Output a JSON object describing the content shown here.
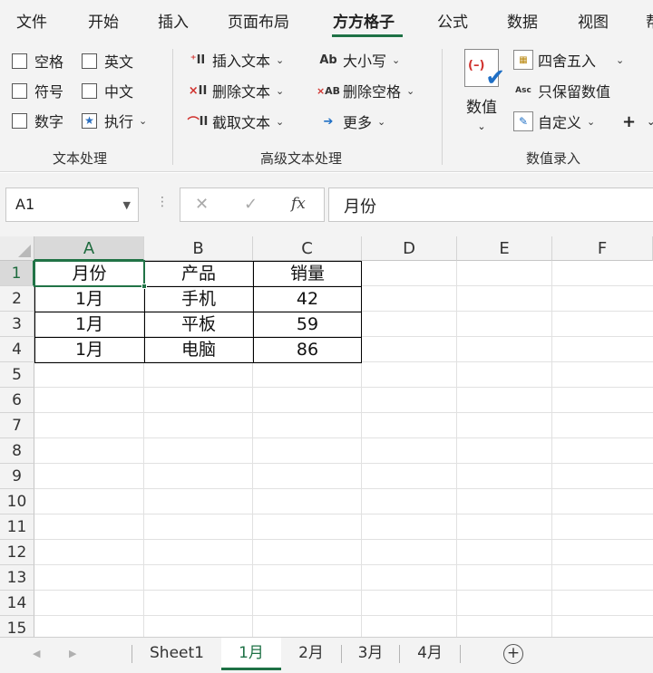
{
  "menu": {
    "items": [
      "文件",
      "开始",
      "插入",
      "页面布局",
      "方方格子",
      "公式",
      "数据",
      "视图",
      "帮"
    ],
    "active_index": 4
  },
  "ribbon": {
    "text_group": {
      "label": "文本处理",
      "checkboxes": [
        "空格",
        "英文",
        "符号",
        "中文",
        "数字"
      ],
      "run_label": "执行"
    },
    "advanced_group": {
      "label": "高级文本处理",
      "buttons": [
        "插入文本",
        "删除文本",
        "截取文本",
        "大小写",
        "删除空格",
        "更多"
      ]
    },
    "numeric_group": {
      "label": "数值录入",
      "big_button": "数值",
      "buttons": [
        "四舍五入",
        "只保留数值",
        "自定义"
      ],
      "plus": "+"
    }
  },
  "formula_bar": {
    "name_box": "A1",
    "content": "月份",
    "fx": "fx"
  },
  "grid": {
    "columns": [
      "A",
      "B",
      "C",
      "D",
      "E",
      "F"
    ],
    "rows": [
      "1",
      "2",
      "3",
      "4",
      "5",
      "6",
      "7",
      "8",
      "9",
      "10",
      "11",
      "12",
      "13",
      "14",
      "15"
    ],
    "selected_cell": "A1",
    "cells": [
      [
        "月份",
        "产品",
        "销量"
      ],
      [
        "1月",
        "手机",
        "42"
      ],
      [
        "1月",
        "平板",
        "59"
      ],
      [
        "1月",
        "电脑",
        "86"
      ]
    ]
  },
  "sheet_tabs": {
    "tabs": [
      "Sheet1",
      "1月",
      "2月",
      "3月",
      "4月"
    ],
    "active_index": 1
  },
  "colors": {
    "accent_green": "#217346",
    "ribbon_bg": "#f3f3f3"
  }
}
